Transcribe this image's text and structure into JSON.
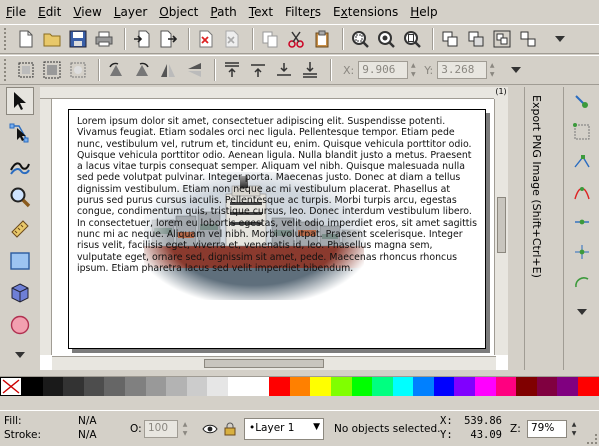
{
  "menu": [
    "File",
    "Edit",
    "View",
    "Layer",
    "Object",
    "Path",
    "Text",
    "Filters",
    "Extensions",
    "Help"
  ],
  "menu_underline": [
    "F",
    "E",
    "V",
    "L",
    "O",
    "P",
    "T",
    "r",
    "x",
    "H"
  ],
  "toolbar_x": {
    "label": "X:",
    "value": "9.906"
  },
  "toolbar_y": {
    "label": "Y:",
    "value": "3.268"
  },
  "ruler_corner": "(1)",
  "document_text": "Lorem ipsum dolor sit amet, consectetuer adipiscing elit. Suspendisse potenti. Vivamus feugiat. Etiam sodales orci nec ligula. Pellentesque tempor. Etiam pede nunc, vestibulum vel, rutrum et, tincidunt eu, enim. Quisque vehicula porttitor odio. Quisque vehicula porttitor odio. Aenean ligula. Nulla blandit justo a metus. Praesent a lacus vitae turpis consequat semper. Aliquam vel nibh. Quisque malesuada nulla sed pede volutpat pulvinar. Integer porta. Maecenas justo. Donec at diam a tellus dignissim vestibulum. Etiam non neque ac mi vestibulum placerat. Phasellus at purus sed purus cursus iaculis. Pellentesque ac turpis. Morbi turpis arcu, egestas congue, condimentum quis, tristique cursus, leo. Donec interdum vestibulum libero. In consectetuer, lorem eu lobortis egestas, velit odio imperdiet eros, sit amet sagittis nunc mi ac neque. Aliquam vel nibh. Morbi volutpat. Praesent scelerisque. Integer risus velit, facilisis eget, viverra et, venenatis id, leo. Phasellus magna sem, vulputate eget, ornare sed, dignissim sit amet, pede. Maecenas rhoncus rhoncus ipsum. Etiam pharetra lacus sed velit imperdiet bibendum.",
  "dock_panel": {
    "title": "Export PNG Image (Shift+Ctrl+E)"
  },
  "palette": {
    "colors": [
      "#000000",
      "#1a1a1a",
      "#333333",
      "#4d4d4d",
      "#666666",
      "#808080",
      "#999999",
      "#b3b3b3",
      "#cccccc",
      "#e6e6e6",
      "#ffffff",
      "#ffffff",
      "#ff0000",
      "#ff8000",
      "#ffff00",
      "#80ff00",
      "#00ff00",
      "#00ff80",
      "#00ffff",
      "#0080ff",
      "#0000ff",
      "#8000ff",
      "#ff00ff",
      "#ff0080",
      "#800000",
      "#800040",
      "#800080",
      "#ff0000"
    ]
  },
  "status": {
    "fill_label": "Fill:",
    "fill_value": "N/A",
    "stroke_label": "Stroke:",
    "stroke_value": "N/A",
    "opacity_label": "O:",
    "opacity_value": "100",
    "layer": "•Layer 1",
    "message": "No objects selected.",
    "x_label": "X:",
    "x_value": "539.86",
    "y_label": "Y:",
    "y_value": "43.09",
    "zoom_label": "Z:",
    "zoom_value": "79%"
  }
}
